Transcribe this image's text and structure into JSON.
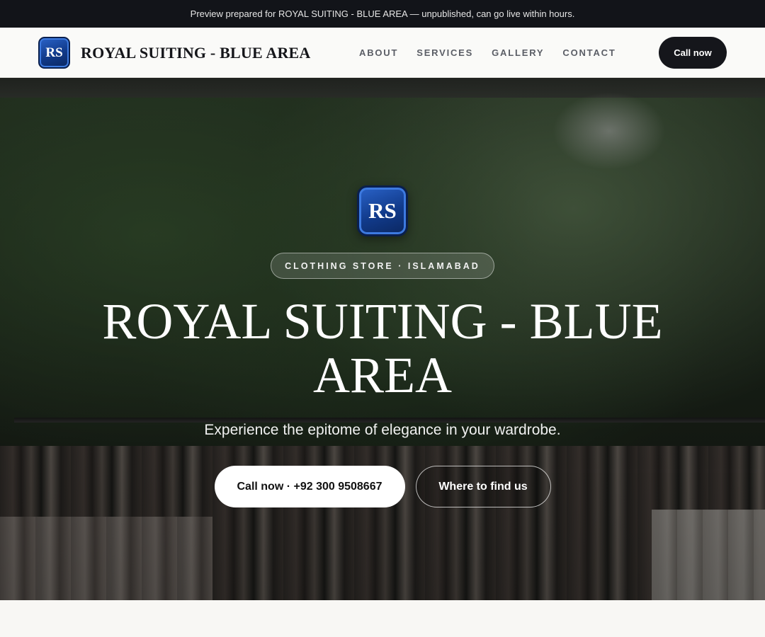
{
  "preview_banner": "Preview prepared for ROYAL SUITING - BLUE AREA — unpublished, can go live within hours.",
  "brand": {
    "logo_text": "RS",
    "name": "ROYAL SUITING - BLUE AREA"
  },
  "nav": {
    "links": [
      "ABOUT",
      "SERVICES",
      "GALLERY",
      "CONTACT"
    ],
    "cta": "Call now"
  },
  "hero": {
    "logo_text": "RS",
    "category": "CLOTHING STORE · ISLAMABAD",
    "title": "ROYAL SUITING - BLUE AREA",
    "tagline": "Experience the epitome of elegance in your wardrobe.",
    "primary_cta": "Call now · +92 300 9508667",
    "secondary_cta": "Where to find us"
  },
  "colors": {
    "brand_blue": "#113a8a",
    "dark": "#15161b",
    "banner_bg": "#121419"
  }
}
